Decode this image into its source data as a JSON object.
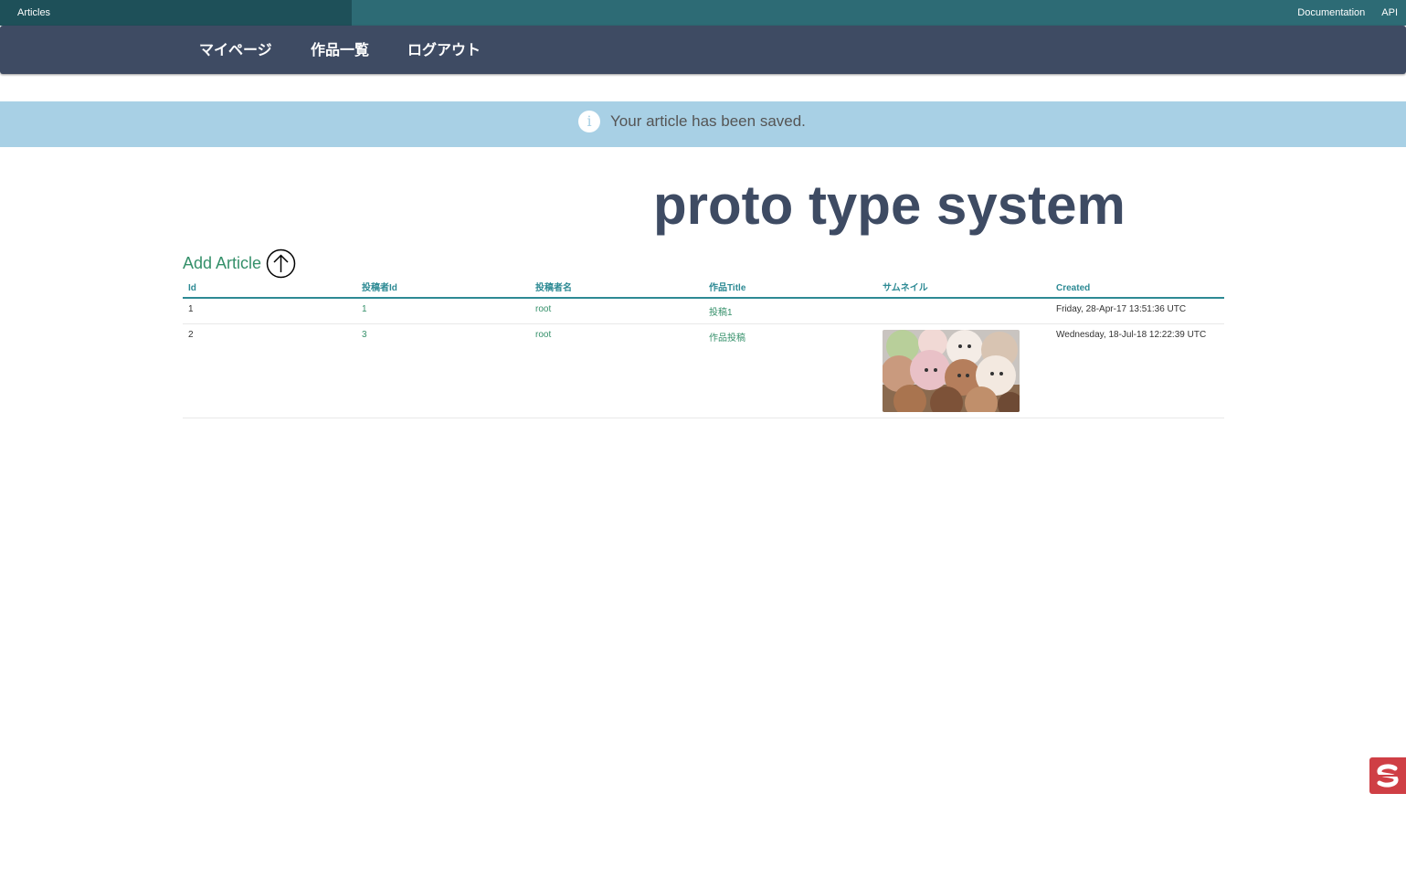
{
  "topbar": {
    "brand": "Articles",
    "links": [
      "Documentation",
      "API"
    ]
  },
  "navbar": {
    "items": [
      "マイページ",
      "作品一覧",
      "ログアウト"
    ]
  },
  "flash": {
    "message": "Your article has been saved.",
    "icon": "info-icon"
  },
  "page": {
    "title": "proto type system",
    "add_label": "Add Article",
    "add_icon": "arrow-up-circle-icon"
  },
  "table": {
    "headers": [
      "Id",
      "投稿者Id",
      "投稿者名",
      "作品Title",
      "サムネイル",
      "Created"
    ],
    "rows": [
      {
        "id": "1",
        "user_id": "1",
        "user_name": "root",
        "title": "投稿1",
        "thumbnail": "",
        "created": "Friday, 28-Apr-17 13:51:36 UTC"
      },
      {
        "id": "2",
        "user_id": "3",
        "user_name": "root",
        "title": "作品投稿",
        "thumbnail": "donut-thumbnail",
        "created": "Wednesday, 18-Jul-18 12:22:39 UTC"
      }
    ]
  },
  "colors": {
    "topbar": "#2d6b75",
    "navbar": "#3e4b63",
    "flash": "#a8d0e5",
    "accent": "#35906a",
    "floating": "#cf3f45"
  },
  "floating_widget": {
    "icon": "app-logo-icon"
  }
}
